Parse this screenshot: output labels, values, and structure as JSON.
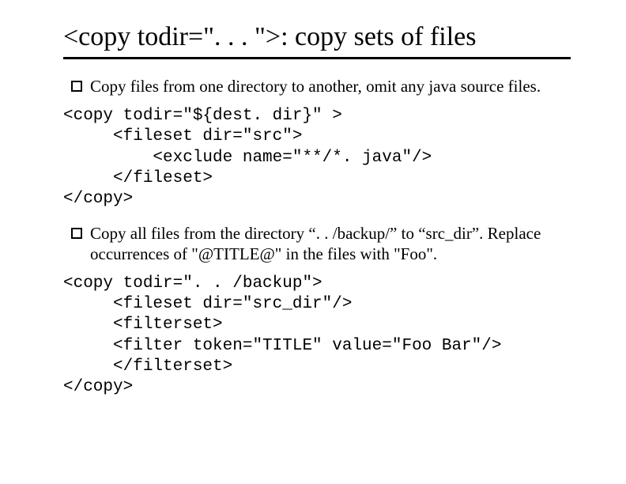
{
  "title": "<copy todir=\". . . \">: copy sets of files",
  "bullets": [
    "Copy files from one directory to another, omit any java source files.",
    "Copy all files from the directory “. . /backup/” to “src_dir”. Replace occurrences of \"@TITLE@\" in the files with \"Foo\"."
  ],
  "code": [
    "<copy todir=\"${dest. dir}\" >\n     <fileset dir=\"src\">\n         <exclude name=\"**/*. java\"/>\n     </fileset>\n</copy>",
    "<copy todir=\". . /backup\">\n     <fileset dir=\"src_dir\"/>\n     <filterset>\n     <filter token=\"TITLE\" value=\"Foo Bar\"/>\n     </filterset>\n</copy>"
  ]
}
